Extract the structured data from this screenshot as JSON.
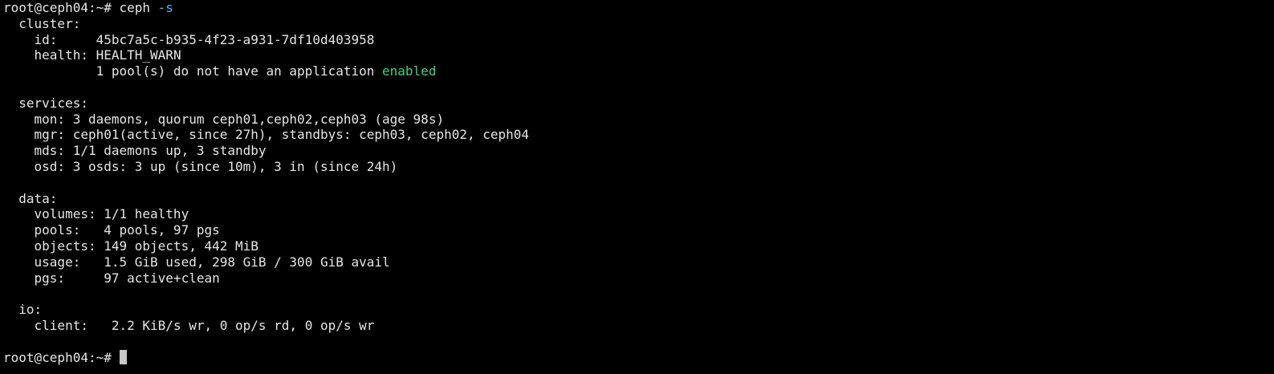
{
  "prompt": "root@ceph04:~#",
  "command": {
    "program": "ceph",
    "flag": "-s"
  },
  "output": {
    "cluster_header": "cluster:",
    "id_label": "id:",
    "id_value": "45bc7a5c-b935-4f23-a931-7df10d403958",
    "health_label": "health:",
    "health_value": "HEALTH_WARN",
    "health_detail_text": "1 pool(s) do not have an application",
    "health_detail_highlight": "enabled",
    "services_header": "services:",
    "mon_label": "mon:",
    "mon_value": "3 daemons, quorum ceph01,ceph02,ceph03 (age 98s)",
    "mgr_label": "mgr:",
    "mgr_value": "ceph01(active, since 27h), standbys: ceph03, ceph02, ceph04",
    "mds_label": "mds:",
    "mds_value": "1/1 daemons up, 3 standby",
    "osd_label": "osd:",
    "osd_value": "3 osds: 3 up (since 10m), 3 in (since 24h)",
    "data_header": "data:",
    "volumes_label": "volumes:",
    "volumes_value": "1/1 healthy",
    "pools_label": "pools:",
    "pools_value": "4 pools, 97 pgs",
    "objects_label": "objects:",
    "objects_value": "149 objects, 442 MiB",
    "usage_label": "usage:",
    "usage_value": "1.5 GiB used, 298 GiB / 300 GiB avail",
    "pgs_label": "pgs:",
    "pgs_value": "97 active+clean",
    "io_header": "io:",
    "client_label": "client:",
    "client_value": "2.2 KiB/s wr, 0 op/s rd, 0 op/s wr"
  },
  "colors": {
    "background": "#000000",
    "text": "#e6e6e6",
    "highlight_green": "#3fd27a",
    "flag_blue": "#5fb0e8",
    "cursor": "#c8c8c8"
  }
}
